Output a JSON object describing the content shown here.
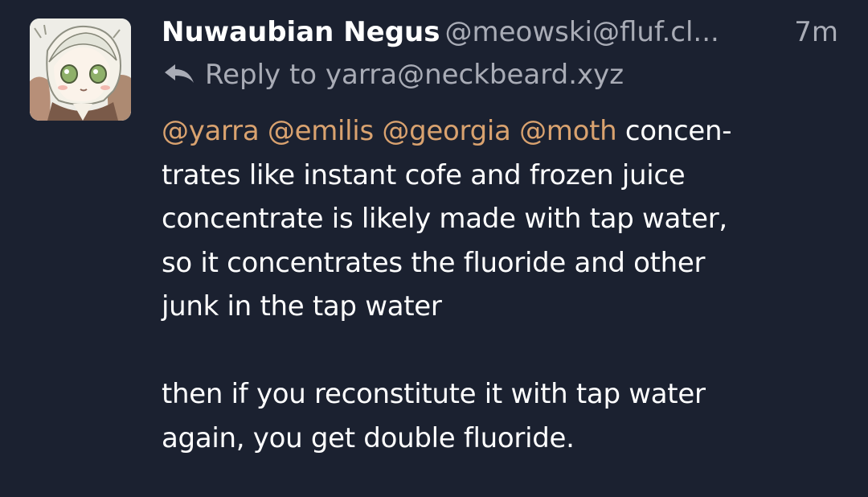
{
  "post": {
    "author": {
      "display_name": "Nuwaubian Negus",
      "handle": "@meowski@fluf.cl..."
    },
    "timestamp": "7m",
    "reply_to": "Reply to yarra@neckbeard.xyz",
    "mentions": [
      "@yarra",
      "@emilis",
      "@georgia",
      "@moth"
    ],
    "paragraph1_lines": [
      " concen-",
      "trates like instant cofe and frozen juice",
      "concentrate is likely made with tap water,",
      "so it concentrates the fluoride and other",
      "junk in the tap water"
    ],
    "paragraph2_lines": [
      "then if you reconstitute it with tap water",
      "again, you get double fluoride."
    ]
  },
  "colors": {
    "background": "#1b2130",
    "text": "#ffffff",
    "muted": "#a9acb6",
    "mention": "#d9a26f"
  },
  "icons": {
    "avatar": "anime-character-avatar",
    "reply": "reply-arrow-icon"
  }
}
